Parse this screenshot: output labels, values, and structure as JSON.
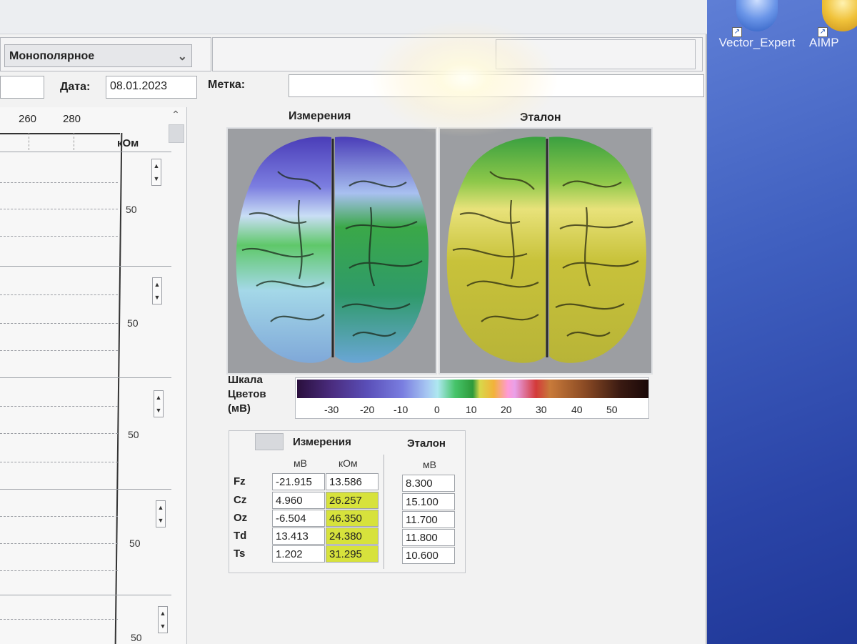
{
  "desktop": {
    "icons": [
      {
        "label": "Vector_Expert",
        "icon": "vector-expert-icon",
        "color": "#3a6fd8"
      },
      {
        "label": "AIMP",
        "icon": "aimp-icon",
        "color": "#e2b223"
      }
    ]
  },
  "toolbar": {
    "mode_select": "Монополярное",
    "date_label": "Дата:",
    "date_value": "08.01.2023",
    "mark_label": "Метка:",
    "mark_value": ""
  },
  "plot": {
    "x_ticks": [
      "260",
      "280"
    ],
    "unit": "кОм",
    "row_values": [
      "50",
      "50",
      "50",
      "50",
      "50"
    ]
  },
  "maps": {
    "measured_title": "Измерения",
    "reference_title": "Эталон"
  },
  "scale": {
    "label_line1": "Шкала",
    "label_line2": "Цветов",
    "label_line3": "(мВ)",
    "ticks": [
      "-30",
      "-20",
      "-10",
      "0",
      "10",
      "20",
      "30",
      "40",
      "50"
    ]
  },
  "table": {
    "measured_header": "Измерения",
    "reference_header": "Эталон",
    "units": {
      "measured_mv": "мВ",
      "measured_kohm": "кОм",
      "reference_mv": "мВ"
    },
    "rows": [
      {
        "label": "Fz",
        "mv": "-21.915",
        "kohm": "13.586",
        "ref": "8.300",
        "kohm_highlight": false
      },
      {
        "label": "Cz",
        "mv": "4.960",
        "kohm": "26.257",
        "ref": "15.100",
        "kohm_highlight": true
      },
      {
        "label": "Oz",
        "mv": "-6.504",
        "kohm": "46.350",
        "ref": "11.700",
        "kohm_highlight": true
      },
      {
        "label": "Td",
        "mv": "13.413",
        "kohm": "24.380",
        "ref": "11.800",
        "kohm_highlight": true
      },
      {
        "label": "Ts",
        "mv": "1.202",
        "kohm": "31.295",
        "ref": "10.600",
        "kohm_highlight": true
      }
    ],
    "highlight_color": "#d7e23c"
  }
}
